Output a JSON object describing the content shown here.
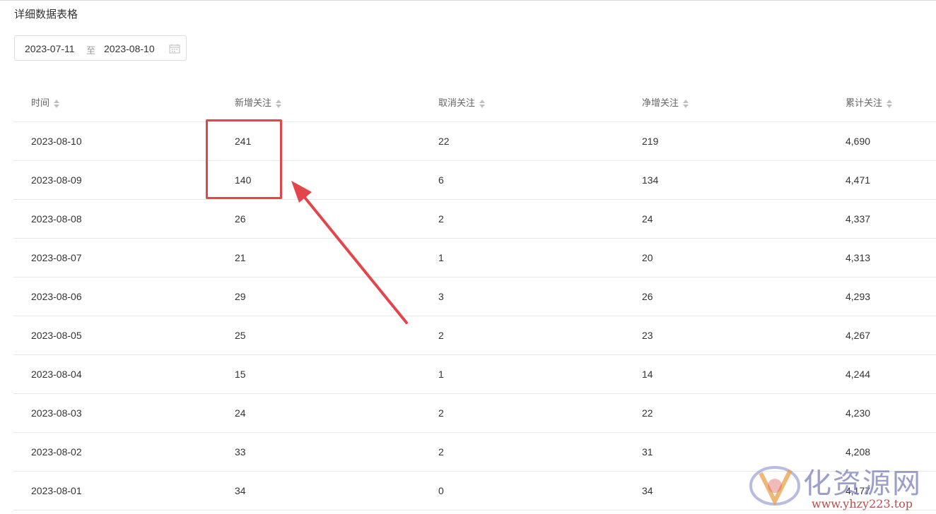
{
  "page": {
    "title": "详细数据表格"
  },
  "date_range": {
    "start": "2023-07-11",
    "separator": "至",
    "end": "2023-08-10"
  },
  "table": {
    "columns": [
      "时间",
      "新增关注",
      "取消关注",
      "净增关注",
      "累计关注"
    ],
    "rows": [
      [
        "2023-08-10",
        "241",
        "22",
        "219",
        "4,690"
      ],
      [
        "2023-08-09",
        "140",
        "6",
        "134",
        "4,471"
      ],
      [
        "2023-08-08",
        "26",
        "2",
        "24",
        "4,337"
      ],
      [
        "2023-08-07",
        "21",
        "1",
        "20",
        "4,313"
      ],
      [
        "2023-08-06",
        "29",
        "3",
        "26",
        "4,293"
      ],
      [
        "2023-08-05",
        "25",
        "2",
        "23",
        "4,267"
      ],
      [
        "2023-08-04",
        "15",
        "1",
        "14",
        "4,244"
      ],
      [
        "2023-08-03",
        "24",
        "2",
        "22",
        "4,230"
      ],
      [
        "2023-08-02",
        "33",
        "2",
        "31",
        "4,208"
      ],
      [
        "2023-08-01",
        "34",
        "0",
        "34",
        "4,177"
      ]
    ]
  },
  "annotation": {
    "color": "#e2454a"
  },
  "watermark": {
    "text": "化资源网",
    "url": "www.yhzy223.top",
    "text_color": "#8a8dc4",
    "url_color": "#b03a3a"
  }
}
